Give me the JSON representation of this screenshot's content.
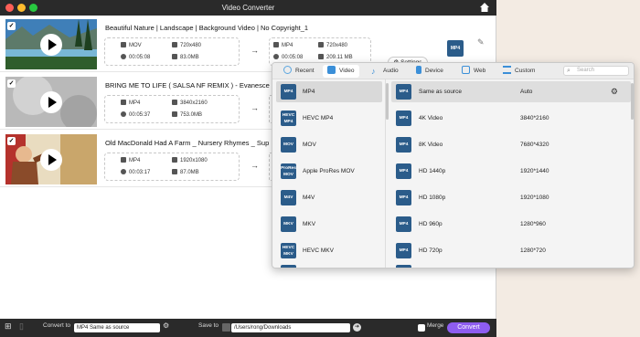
{
  "window": {
    "title": "Video Converter"
  },
  "videos": [
    {
      "title": "Beautiful Nature | Landscape | Background Video | No Copyright_1",
      "src_format": "MOV",
      "src_resolution": "720x480",
      "src_duration": "00:05:08",
      "src_size": "83.0MB",
      "dst_format": "MP4",
      "dst_resolution": "720x480",
      "dst_duration": "00:05:08",
      "dst_size": "209.11 MB"
    },
    {
      "title": "BRING ME TO LIFE ( SALSA   NF REMIX ) - Evanescen",
      "src_format": "MP4",
      "src_resolution": "3840x2160",
      "src_duration": "00:05:37",
      "src_size": "753.0MB"
    },
    {
      "title": "Old MacDonald Had A Farm _ Nursery Rhymes _ Sup",
      "src_format": "MP4",
      "src_resolution": "1920x1080",
      "src_duration": "00:03:17",
      "src_size": "87.0MB"
    }
  ],
  "settings_label": "Settings",
  "output_badge": "MP4",
  "format_panel": {
    "tabs": [
      "Recent",
      "Video",
      "Audio",
      "Device",
      "Web",
      "Custom"
    ],
    "active_tab": "Video",
    "search_placeholder": "Search",
    "formats": [
      {
        "name": "MP4",
        "badge": "MP4"
      },
      {
        "name": "HEVC MP4",
        "badge": "HEVC MP4"
      },
      {
        "name": "MOV",
        "badge": "MOV"
      },
      {
        "name": "Apple ProRes MOV",
        "badge": "ProRes MOV"
      },
      {
        "name": "M4V",
        "badge": "M4V"
      },
      {
        "name": "MKV",
        "badge": "MKV"
      },
      {
        "name": "HEVC MKV",
        "badge": "HEVC MKV"
      }
    ],
    "presets": [
      {
        "name": "Same as source",
        "res": "Auto"
      },
      {
        "name": "4K Video",
        "res": "3840*2160"
      },
      {
        "name": "8K Video",
        "res": "7680*4320"
      },
      {
        "name": "HD 1440p",
        "res": "1920*1440"
      },
      {
        "name": "HD 1080p",
        "res": "1920*1080"
      },
      {
        "name": "HD 960p",
        "res": "1280*960"
      },
      {
        "name": "HD 720p",
        "res": "1280*720"
      }
    ]
  },
  "bottom": {
    "convert_to_label": "Convert to",
    "convert_to_value": "MP4 Same as source",
    "save_to_label": "Save to",
    "save_to_value": "/Users/rong/Downloads",
    "merge_label": "Merge",
    "convert_button": "Convert"
  },
  "colors": {
    "accent": "#8e5df0",
    "badge": "#2b5c8a",
    "titlebar": "#2a2a2a"
  }
}
